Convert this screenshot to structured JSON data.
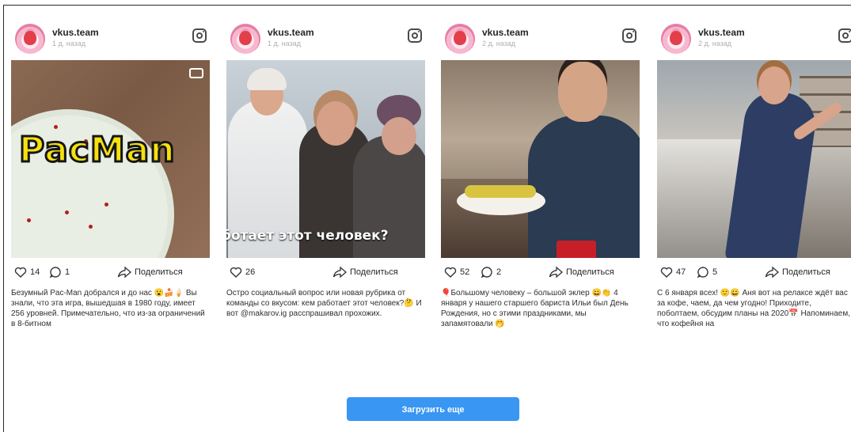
{
  "posts": [
    {
      "username": "vkus.team",
      "subtitle": "1 д. назад",
      "likes": "14",
      "comments": "1",
      "share_label": "Поделиться",
      "overlay_text": "PacMan",
      "caption": "Безумный Pac-Man добрался и до нас 😮🍰🍦 Вы знали, что эта игра, вышедшая в 1980 году, имеет 256 уровней. Примечательно, что из-за ограничений в 8-битном"
    },
    {
      "username": "vkus.team",
      "subtitle": "1 д. назад",
      "likes": "26",
      "comments": "",
      "share_label": "Поделиться",
      "overlay_text": "ботает этот человек?",
      "caption": "Остро социальный вопрос или новая рубрика от команды со вкусом: кем работает этот человек?🤔 И вот @makarov.ig расспрашивал прохожих."
    },
    {
      "username": "vkus.team",
      "subtitle": "2 д. назад",
      "likes": "52",
      "comments": "2",
      "share_label": "Поделиться",
      "caption": "🎈Большому человеку – большой эклер 😀👏 4 января у нашего старшего бариста Ильи был День Рождения, но с этими праздниками, мы запамятовали 🤭"
    },
    {
      "username": "vkus.team",
      "subtitle": "2 д. назад",
      "likes": "47",
      "comments": "5",
      "share_label": "Поделиться",
      "caption": "С 6 января всех! 🙂😀 Аня вот на релаксе ждёт вас за кофе, чаем, да чем угодно! Приходите, поболтаем, обсудим планы на 2020📅 Напоминаем, что кофейня на"
    }
  ],
  "load_more_label": "Загрузить еще",
  "colors": {
    "accent": "#3996f3",
    "text": "#262626",
    "muted": "#b0b0b0"
  }
}
